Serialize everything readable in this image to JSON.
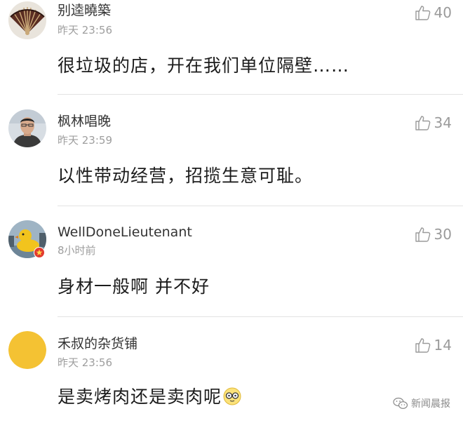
{
  "comments": [
    {
      "username": "别逵曉築",
      "time": "昨天 23:56",
      "likes": "40",
      "text": "很垃圾的店，开在我们单位隔壁……",
      "avatar_icon": "folding-fan-icon"
    },
    {
      "username": "枫林唱晚",
      "time": "昨天 23:59",
      "likes": "34",
      "text": "以性带动经营，招揽生意可耻。",
      "avatar_icon": "man-portrait-icon"
    },
    {
      "username": "WellDoneLieutenant",
      "time": "8小时前",
      "likes": "30",
      "text": "身材一般啊 并不好",
      "avatar_icon": "rubber-duck-icon"
    },
    {
      "username": "禾叔的杂货铺",
      "time": "昨天 23:56",
      "likes": "14",
      "text": "是卖烤肉还是卖肉呢",
      "avatar_icon": "yellow-circle-icon"
    }
  ],
  "watermark": {
    "text": "新闻晨报",
    "icon": "wechat-icon"
  },
  "colors": {
    "username": "#333333",
    "meta": "#9e9e9e",
    "like": "#9a9a9a",
    "text": "#1c1c1c",
    "divider": "#e3e3e3",
    "avatar_yellow": "#f4c233"
  }
}
